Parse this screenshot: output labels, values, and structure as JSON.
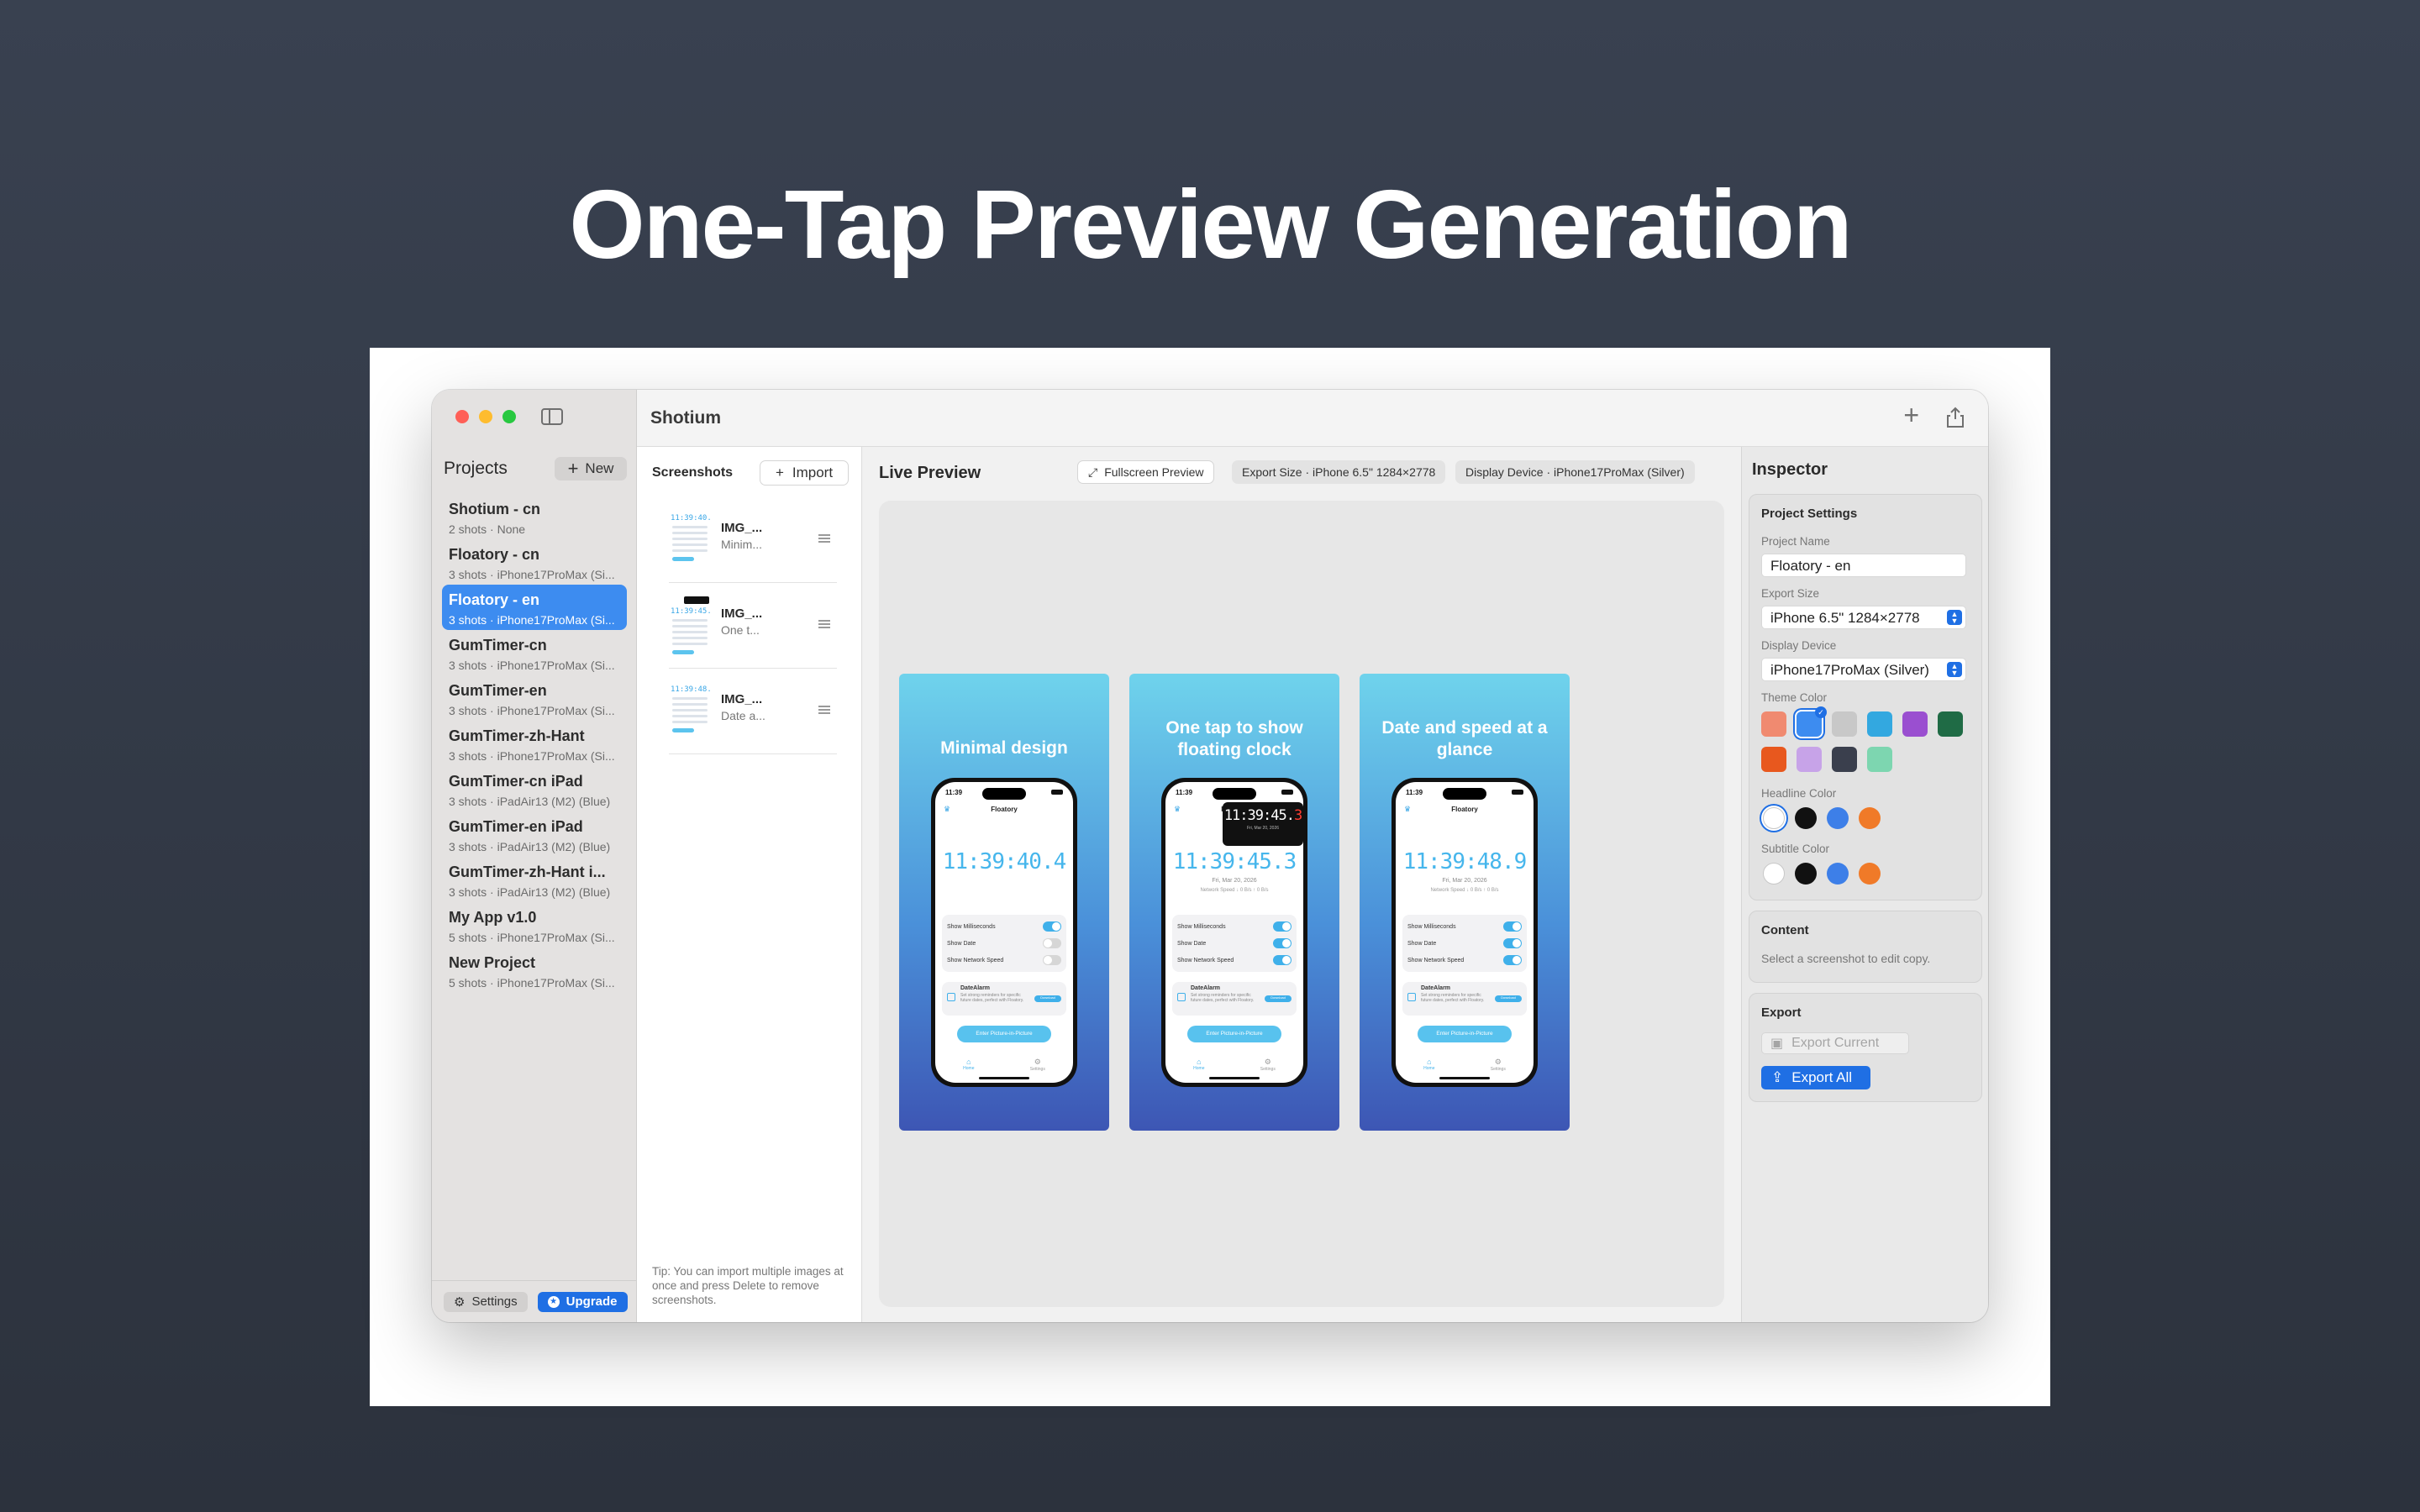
{
  "headline": "One-Tap Preview Generation",
  "app": {
    "title": "Shotium"
  },
  "sidebar": {
    "title": "Projects",
    "new_label": "New",
    "projects": [
      {
        "name": "Shotium - cn",
        "meta": "2 shots · None"
      },
      {
        "name": "Floatory - cn",
        "meta": "3 shots · iPhone17ProMax (Si..."
      },
      {
        "name": "Floatory - en",
        "meta": "3 shots · iPhone17ProMax (Si...",
        "active": true
      },
      {
        "name": "GumTimer-cn",
        "meta": "3 shots · iPhone17ProMax (Si..."
      },
      {
        "name": "GumTimer-en",
        "meta": "3 shots · iPhone17ProMax (Si..."
      },
      {
        "name": "GumTimer-zh-Hant",
        "meta": "3 shots · iPhone17ProMax (Si..."
      },
      {
        "name": "GumTimer-cn iPad",
        "meta": "3 shots · iPadAir13 (M2) (Blue)"
      },
      {
        "name": "GumTimer-en iPad",
        "meta": "3 shots · iPadAir13 (M2) (Blue)"
      },
      {
        "name": "GumTimer-zh-Hant i...",
        "meta": "3 shots · iPadAir13 (M2) (Blue)"
      },
      {
        "name": "My App v1.0",
        "meta": "5 shots · iPhone17ProMax (Si..."
      },
      {
        "name": "New Project",
        "meta": "5 shots · iPhone17ProMax (Si..."
      }
    ],
    "settings_label": "Settings",
    "upgrade_label": "Upgrade"
  },
  "screenshots": {
    "title": "Screenshots",
    "import_label": "Import",
    "items": [
      {
        "name": "IMG_...",
        "sub": "Minim...",
        "thumb_time": "11:39:40.4"
      },
      {
        "name": "IMG_...",
        "sub": "One t...",
        "thumb_time": "11:39:45.3"
      },
      {
        "name": "IMG_...",
        "sub": "Date a...",
        "thumb_time": "11:39:48.9"
      }
    ],
    "tip": "Tip: You can import multiple images at once and press Delete to remove screenshots."
  },
  "preview": {
    "title": "Live Preview",
    "fullscreen_label": "Fullscreen Preview",
    "export_size_chip": "Export Size · iPhone 6.5\" 1284×2778",
    "display_device_chip": "Display Device · iPhone17ProMax (Silver)",
    "cards": [
      {
        "title": "Minimal design",
        "time": "11:39:40.4"
      },
      {
        "title": "One tap to show floating clock",
        "time": "11:39:45.3",
        "float_time_main": "11:39:45.",
        "float_time_red": "3"
      },
      {
        "title": "Date and speed at a glance",
        "time": "11:39:48.9"
      }
    ],
    "phone": {
      "status_time": "11:39",
      "app_name": "Floatory",
      "date": "Fri, Mar 20, 2026",
      "speed": "Network Speed ↓ 0 B/s ↑ 0 B/s",
      "options": [
        "Show Milliseconds",
        "Show Date",
        "Show Network Speed"
      ],
      "alarm_title": "DateAlarm",
      "alarm_desc": "Set strong reminders for specific future dates, perfect with Floatory.",
      "alarm_btn": "Download",
      "pip_label": "Enter Picture-in-Picture",
      "tabs": [
        "Home",
        "Settings"
      ]
    }
  },
  "inspector": {
    "title": "Inspector",
    "project_settings_title": "Project Settings",
    "project_name_label": "Project Name",
    "project_name": "Floatory - en",
    "export_size_label": "Export Size",
    "export_size": "iPhone 6.5\" 1284×2778",
    "display_device_label": "Display Device",
    "display_device": "iPhone17ProMax (Silver)",
    "theme_color_label": "Theme Color",
    "headline_color_label": "Headline Color",
    "subtitle_color_label": "Subtitle Color",
    "content_title": "Content",
    "content_hint": "Select a screenshot to edit copy.",
    "export_title": "Export",
    "export_current_label": "Export Current",
    "export_all_label": "Export All"
  },
  "colors": {
    "accent": "#1f6fe4",
    "theme_swatches": [
      "#f08a70",
      "#3d8cf0",
      "#c8c8c8",
      "#33a8e0",
      "#9a4fd0",
      "#1f6b45",
      "#e8581e",
      "#c7a3e8",
      "#3a3f4d",
      "#7dd6b0"
    ],
    "headline_dots": [
      "#ffffff",
      "#111111",
      "#3d7fe8",
      "#f07a28"
    ],
    "subtitle_dots": [
      "#ffffff",
      "#111111",
      "#3d7fe8",
      "#f07a28"
    ]
  }
}
